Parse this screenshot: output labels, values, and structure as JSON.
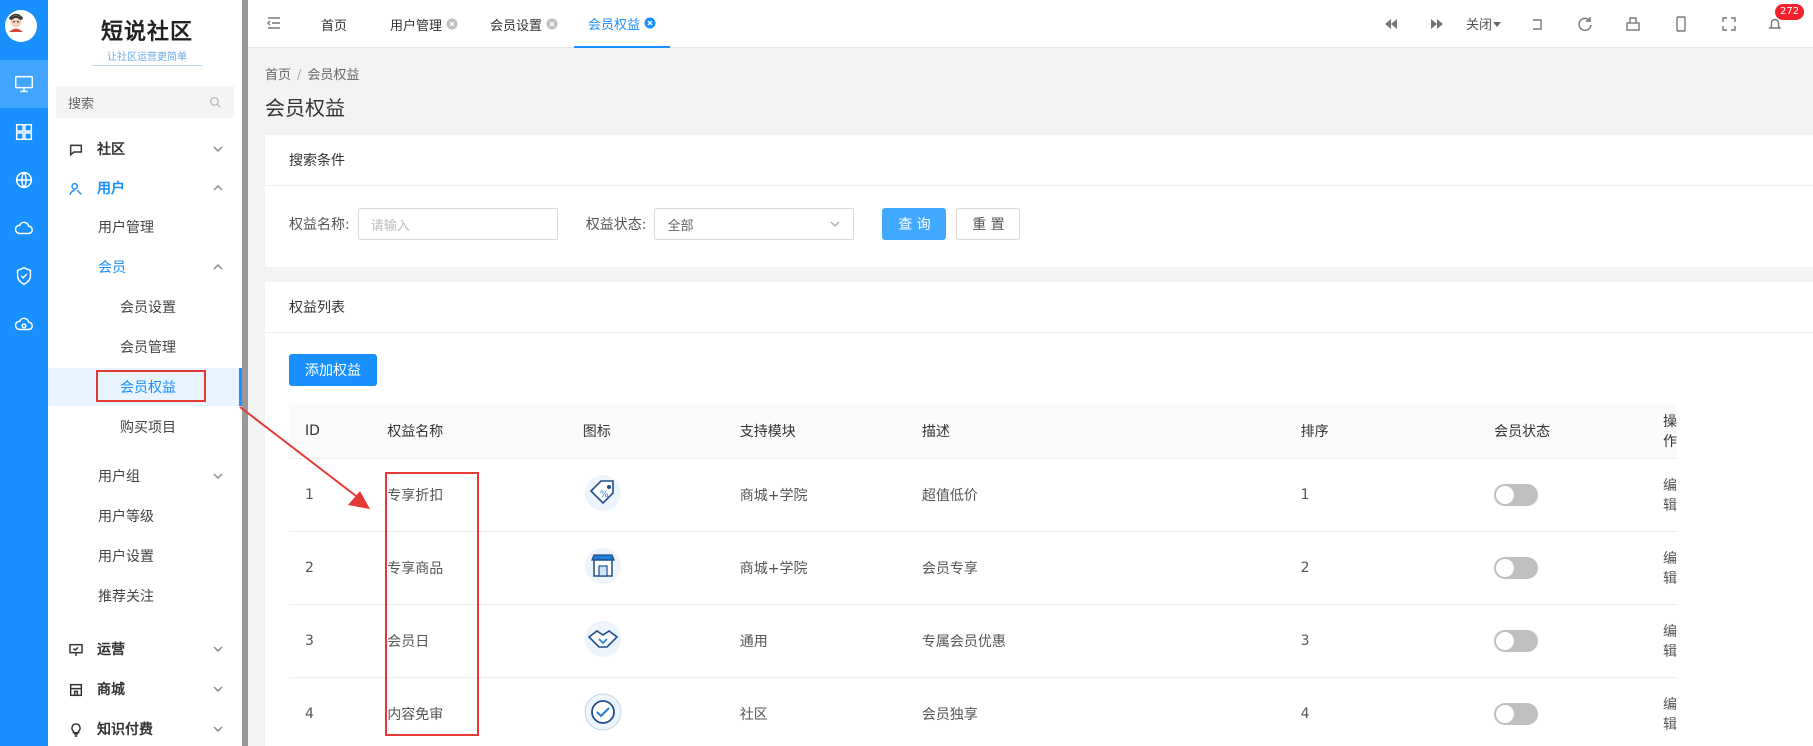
{
  "brand": {
    "title": "短说社区",
    "slogan": "让社区运营更简单"
  },
  "sidebar": {
    "search_placeholder": "搜索",
    "groups": [
      {
        "label": "社区"
      },
      {
        "label": "用户"
      },
      {
        "label": "运营"
      },
      {
        "label": "商城"
      },
      {
        "label": "知识付费"
      }
    ],
    "user_items": {
      "user_manage": "用户管理",
      "member": "会员",
      "member_settings": "会员设置",
      "member_manage": "会员管理",
      "member_rights": "会员权益",
      "purchase_items": "购买项目",
      "user_group": "用户组",
      "user_level": "用户等级",
      "user_settings": "用户设置",
      "recommend_follow": "推荐关注"
    }
  },
  "tabs": [
    {
      "label": "首页"
    },
    {
      "label": "用户管理"
    },
    {
      "label": "会员设置"
    },
    {
      "label": "会员权益"
    }
  ],
  "toolbar": {
    "close_label": "关闭",
    "notification_count": "272"
  },
  "breadcrumb": {
    "home": "首页",
    "current": "会员权益"
  },
  "page_title": "会员权益",
  "search_card": {
    "title": "搜索条件",
    "name_label": "权益名称:",
    "name_placeholder": "请输入",
    "status_label": "权益状态:",
    "status_value": "全部",
    "query_button": "查 询",
    "reset_button": "重 置"
  },
  "list_card": {
    "title": "权益列表",
    "add_button": "添加权益",
    "columns": [
      "ID",
      "权益名称",
      "图标",
      "支持模块",
      "描述",
      "排序",
      "会员状态",
      "操作"
    ],
    "rows": [
      {
        "id": "1",
        "name": "专享折扣",
        "icon": "discount-tag-icon",
        "module": "商城+学院",
        "desc": "超值低价",
        "sort": "1",
        "enabled": false,
        "action": "编辑"
      },
      {
        "id": "2",
        "name": "专享商品",
        "icon": "shop-icon",
        "module": "商城+学院",
        "desc": "会员专享",
        "sort": "2",
        "enabled": false,
        "action": "编辑"
      },
      {
        "id": "3",
        "name": "会员日",
        "icon": "handshake-icon",
        "module": "通用",
        "desc": "专属会员优惠",
        "sort": "3",
        "enabled": false,
        "action": "编辑"
      },
      {
        "id": "4",
        "name": "内容免审",
        "icon": "check-badge-icon",
        "module": "社区",
        "desc": "会员独享",
        "sort": "4",
        "enabled": false,
        "action": "编辑"
      }
    ]
  },
  "colors": {
    "primary": "#1890ff",
    "annotation": "#e53935"
  }
}
